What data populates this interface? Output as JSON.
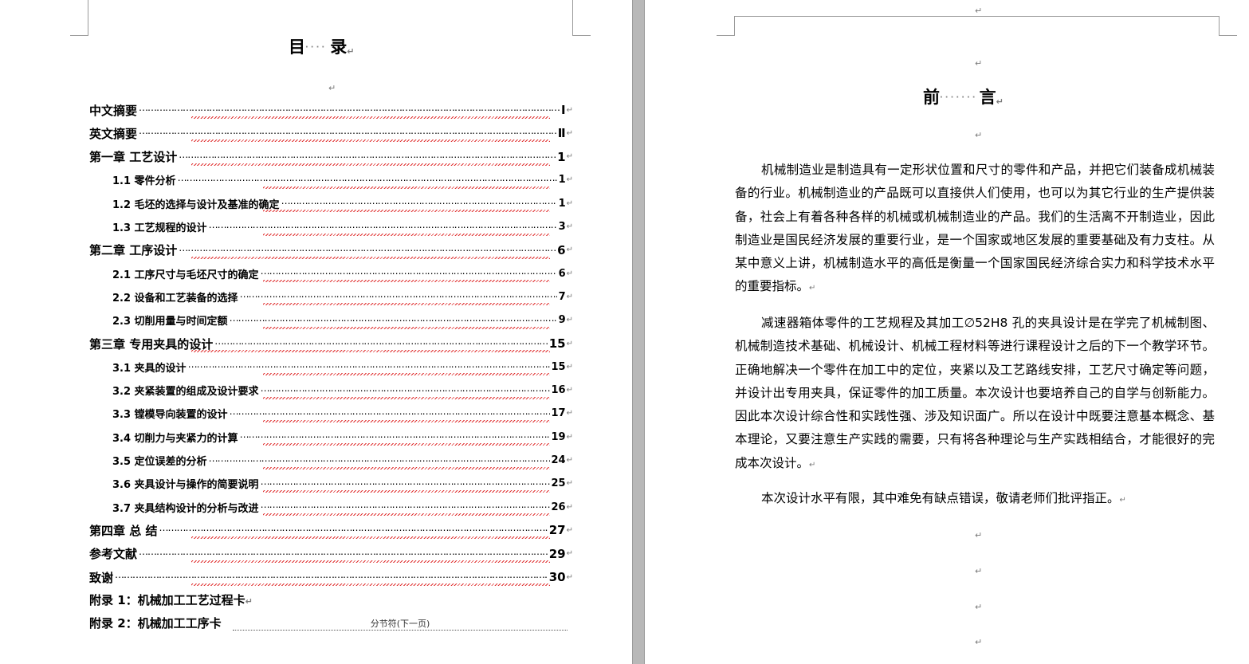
{
  "toc": {
    "title_left": "目",
    "title_right": "录",
    "title_dots": "····",
    "entries": [
      {
        "text": "中文摘要",
        "page": "Ⅰ",
        "sub": false
      },
      {
        "text": "英文摘要",
        "page": "Ⅱ",
        "sub": false
      },
      {
        "text": "第一章  工艺设计",
        "page": "1",
        "sub": false
      },
      {
        "text": "1.1 零件分析",
        "page": "1",
        "sub": true
      },
      {
        "text": "1.2  毛坯的选择与设计及基准的确定",
        "page": "1",
        "sub": true
      },
      {
        "text": "1.3  工艺规程的设计",
        "page": "3",
        "sub": true
      },
      {
        "text": "第二章  工序设计",
        "page": "6",
        "sub": false
      },
      {
        "text": "2.1 工序尺寸与毛坯尺寸的确定",
        "page": "6",
        "sub": true
      },
      {
        "text": "2.2  设备和工艺装备的选择",
        "page": "7",
        "sub": true
      },
      {
        "text": "2.3  切削用量与时间定额",
        "page": "9",
        "sub": true
      },
      {
        "text": "第三章  专用夹具的设计",
        "page": "15",
        "sub": false
      },
      {
        "text": "3.1  夹具的设计",
        "page": "15",
        "sub": true
      },
      {
        "text": "3.2  夹紧装置的组成及设计要求",
        "page": "16",
        "sub": true
      },
      {
        "text": "3.3  镗模导向装置的设计",
        "page": "17",
        "sub": true
      },
      {
        "text": "3.4  切削力与夹紧力的计算",
        "page": "19",
        "sub": true
      },
      {
        "text": "3.5 定位误差的分析",
        "page": "24",
        "sub": true
      },
      {
        "text": "3.6  夹具设计与操作的简要说明",
        "page": "25",
        "sub": true
      },
      {
        "text": "3.7  夹具结构设计的分析与改进",
        "page": "26",
        "sub": true
      },
      {
        "text": "第四章  总 结",
        "page": "27",
        "sub": false
      },
      {
        "text": "参考文献",
        "page": "29",
        "sub": false
      },
      {
        "text": "致谢",
        "page": "30",
        "sub": false
      }
    ],
    "appendix1": "附录 1：机械加工工艺过程卡",
    "appendix2": "附录 2：机械加工工序卡",
    "section_break": "分节符(下一页)"
  },
  "preface": {
    "title_left": "前",
    "title_right": "言",
    "title_dots": "·······",
    "paragraphs": [
      "机械制造业是制造具有一定形状位置和尺寸的零件和产品，并把它们装备成机械装备的行业。机械制造业的产品既可以直接供人们使用，也可以为其它行业的生产提供装备，社会上有着各种各样的机械或机械制造业的产品。我们的生活离不开制造业，因此制造业是国民经济发展的重要行业，是一个国家或地区发展的重要基础及有力支柱。从某中意义上讲，机械制造水平的高低是衡量一个国家国民经济综合实力和科学技术水平的重要指标。",
      "减速器箱体零件的工艺规程及其加工∅52H8 孔的夹具设计是在学完了机械制图、机械制造技术基础、机械设计、机械工程材料等进行课程设计之后的下一个教学环节。正确地解决一个零件在加工中的定位，夹紧以及工艺路线安排，工艺尺寸确定等问题，并设计出专用夹具，保证零件的加工质量。本次设计也要培养自己的自学与创新能力。因此本次设计综合性和实践性强、涉及知识面广。所以在设计中既要注意基本概念、基本理论，又要注意生产实践的需要，只有将各种理论与生产实践相结合，才能很好的完成本次设计。",
      "本次设计水平有限，其中难免有缺点错误，敬请老师们批评指正。"
    ]
  },
  "marks": {
    "paragraph_mark": "↵"
  },
  "colors": {
    "gutter": "#b8b8b8",
    "spellcheck": "#e03030"
  }
}
